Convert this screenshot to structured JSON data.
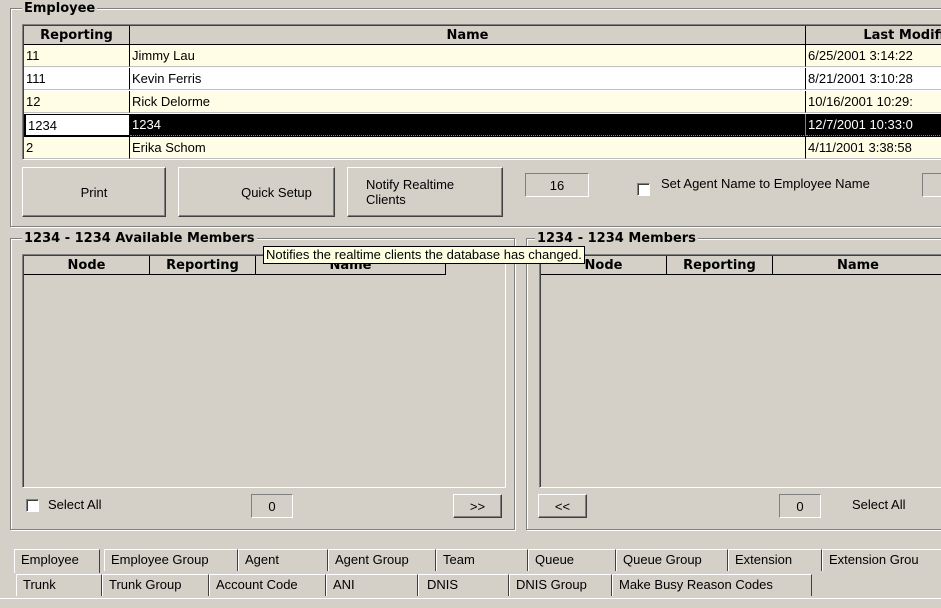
{
  "employee_group": {
    "title": "Employee",
    "columns": [
      "Reporting",
      "Name",
      "Last Modifie"
    ],
    "rows": [
      {
        "reporting": "11",
        "name": "Jimmy Lau",
        "last_modified": "6/25/2001 3:14:22"
      },
      {
        "reporting": "111",
        "name": "Kevin Ferris",
        "last_modified": "8/21/2001 3:10:28"
      },
      {
        "reporting": "12",
        "name": "Rick Delorme",
        "last_modified": "10/16/2001 10:29:"
      },
      {
        "reporting": "1234",
        "name": "1234",
        "last_modified": "12/7/2001 10:33:0"
      },
      {
        "reporting": "2",
        "name": "Erika Schom",
        "last_modified": "4/11/2001 3:38:58"
      }
    ],
    "selected_index": 3
  },
  "toolbar": {
    "print_label": "Print",
    "quick_setup_label": "Quick Setup",
    "notify_label": "Notify Realtime Clients",
    "count_value": "16",
    "set_agent_name_label": "Set Agent Name to Employee Name"
  },
  "tooltip": {
    "text": "Notifies the realtime clients the database has changed."
  },
  "available_members": {
    "title": "1234 - 1234 Available Members",
    "columns": [
      "Node",
      "Reporting",
      "Name"
    ],
    "select_all_label": "Select All",
    "count_value": "0",
    "move_button_label": ">>"
  },
  "members": {
    "title": "1234 - 1234 Members",
    "columns": [
      "Node",
      "Reporting",
      "Name"
    ],
    "move_button_label": "<<",
    "count_value": "0",
    "select_all_label": "Select All"
  },
  "tabs": {
    "row1": [
      "Employee",
      "Employee Group",
      "Agent",
      "Agent Group",
      "Team",
      "Queue",
      "Queue Group",
      "Extension",
      "Extension Grou"
    ],
    "row2": [
      "Trunk",
      "Trunk Group",
      "Account Code",
      "ANI",
      "DNIS",
      "DNIS Group",
      "Make Busy Reason Codes"
    ],
    "active": "Employee"
  }
}
